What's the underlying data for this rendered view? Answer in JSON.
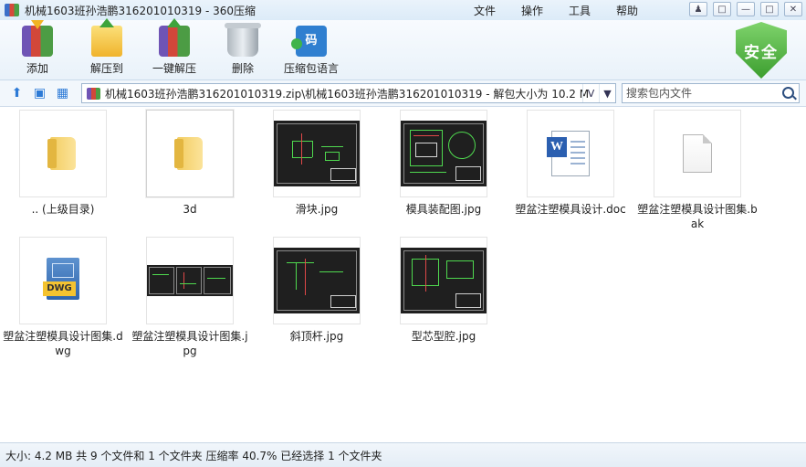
{
  "window": {
    "title": "机械1603班孙浩鹏316201010319 - 360压缩",
    "menu": [
      "文件",
      "操作",
      "工具",
      "帮助"
    ]
  },
  "toolbar": {
    "add": "添加",
    "extract": "解压到",
    "one_click": "一键解压",
    "delete": "删除",
    "language": "压缩包语言",
    "language_icon_text": "码"
  },
  "shield": {
    "label": "安全"
  },
  "address": {
    "path": "机械1603班孙浩鹏316201010319.zip\\机械1603班孙浩鹏316201010319 - 解包大小为 10.2 MB",
    "dropdown": "V"
  },
  "search": {
    "placeholder": "搜索包内文件"
  },
  "files": [
    {
      "name": ".. (上级目录)",
      "type": "folder"
    },
    {
      "name": "3d",
      "type": "folder",
      "selected": true
    },
    {
      "name": "滑块.jpg",
      "type": "image"
    },
    {
      "name": "模具装配图.jpg",
      "type": "image"
    },
    {
      "name": "塑盆注塑模具设计.doc",
      "type": "doc"
    },
    {
      "name": "塑盆注塑模具设计图集.bak",
      "type": "bak"
    },
    {
      "name": "塑盆注塑模具设计图集.dwg",
      "type": "dwg",
      "icon_text": "DWG"
    },
    {
      "name": "塑盆注塑模具设计图集.jpg",
      "type": "image"
    },
    {
      "name": "斜顶杆.jpg",
      "type": "image"
    },
    {
      "name": "型芯型腔.jpg",
      "type": "image"
    }
  ],
  "status": "大小: 4.2 MB 共 9 个文件和 1 个文件夹 压缩率 40.7% 已经选择 1 个文件夹"
}
